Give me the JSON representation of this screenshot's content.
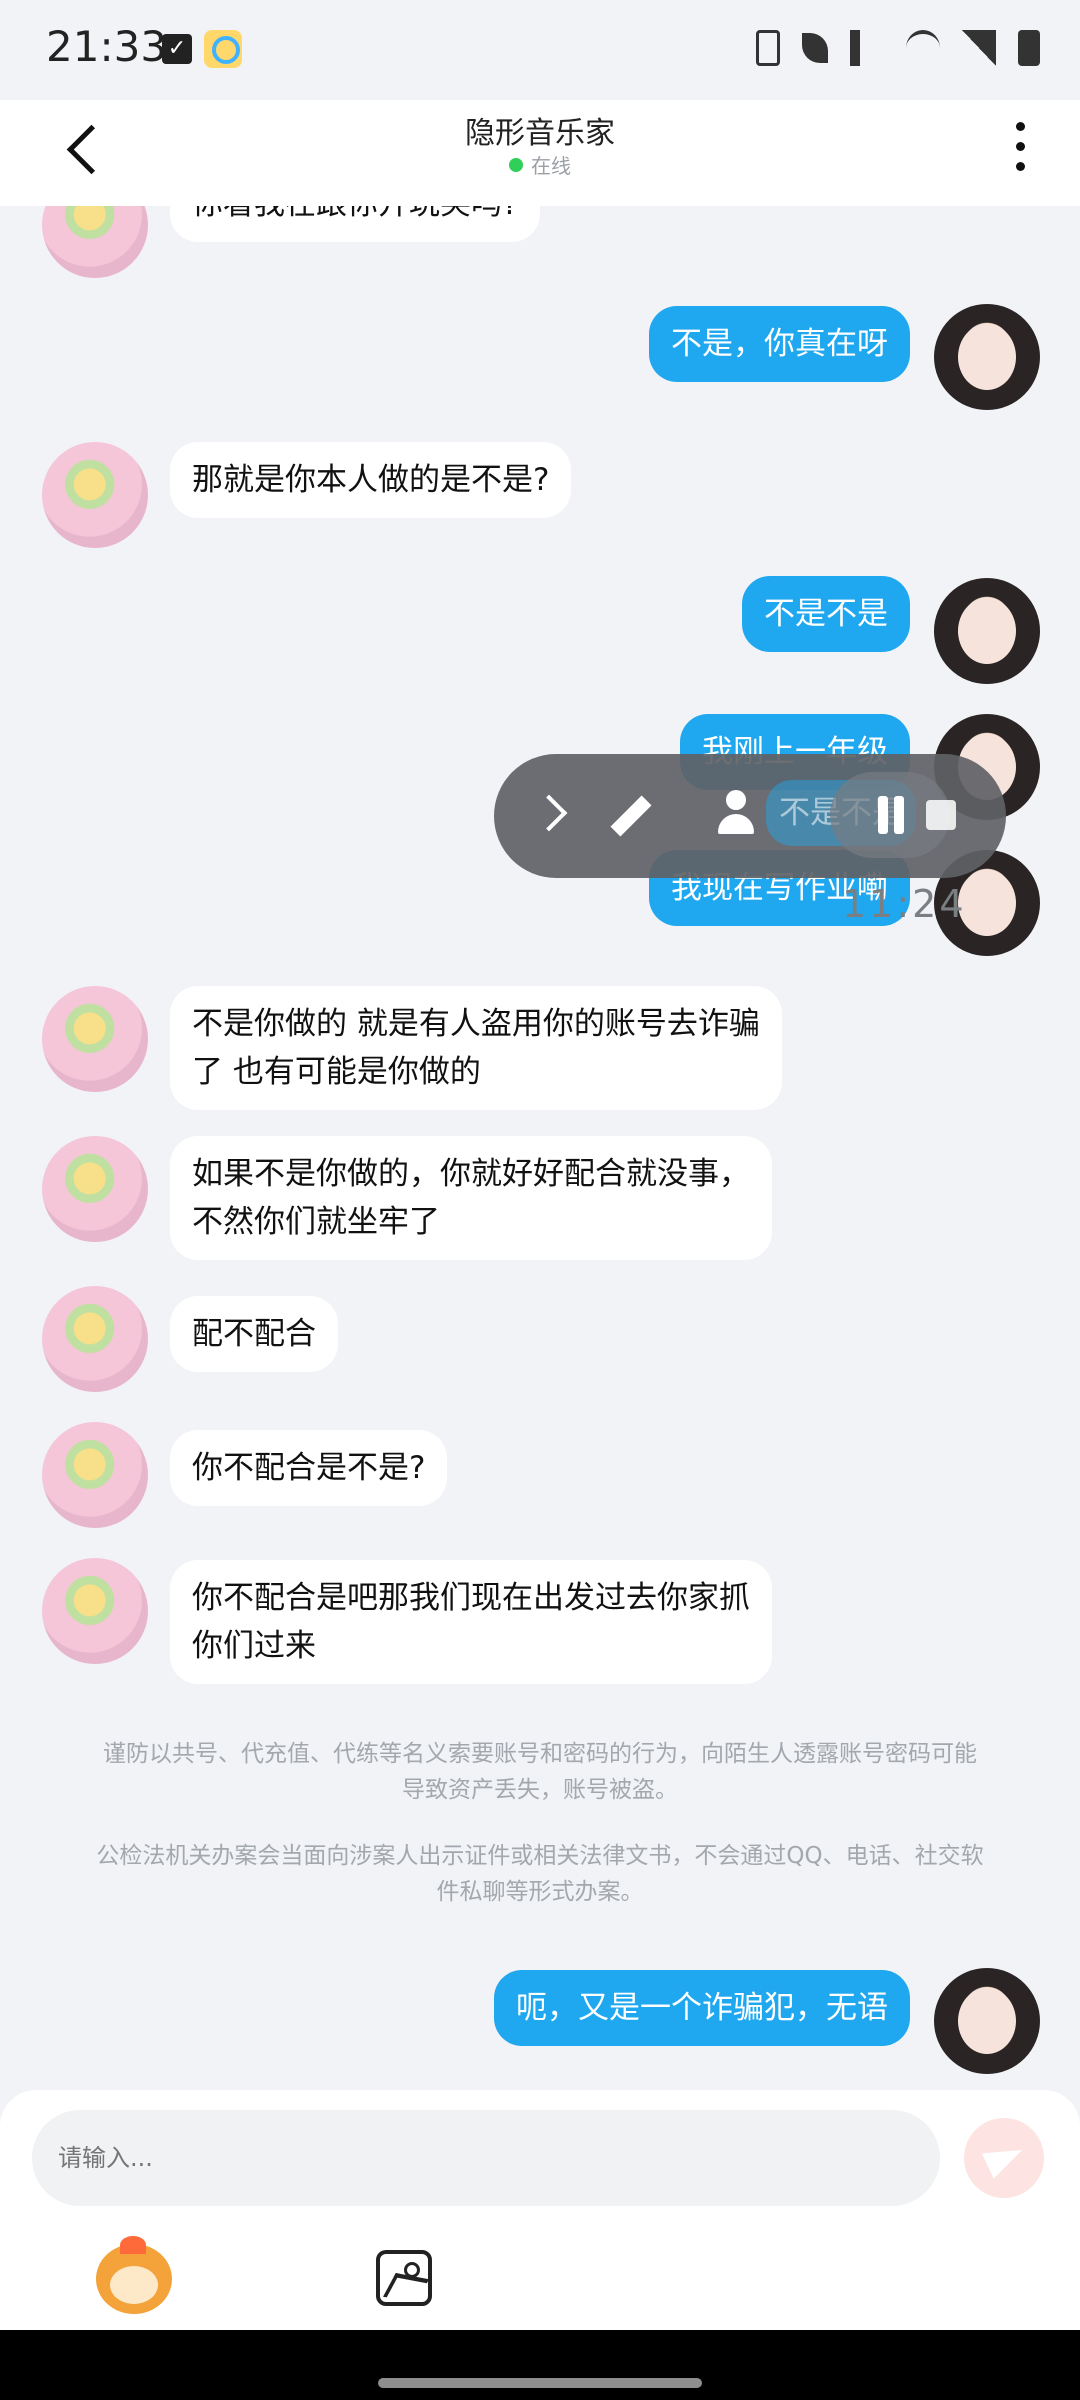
{
  "status_bar": {
    "time": "21:33"
  },
  "header": {
    "title": "隐形音乐家",
    "status": "在线"
  },
  "messages": [
    {
      "from": "other",
      "text": "你看我在跟你开玩笑吗?"
    },
    {
      "from": "me",
      "text": "不是，你真在呀"
    },
    {
      "from": "other",
      "text": "那就是你本人做的是不是?"
    },
    {
      "from": "me",
      "text": "不是不是"
    },
    {
      "from": "me",
      "text": "我刚上一年级"
    },
    {
      "from": "me",
      "text": "我现在写作业嘞"
    },
    {
      "from": "other",
      "text_lines": [
        "不是你做的 就是有人盗用你的账号去诈骗",
        "了 也有可能是你做的"
      ]
    },
    {
      "from": "other",
      "text_lines": [
        "如果不是你做的，你就好好配合就没事，",
        "不然你们就坐牢了"
      ]
    },
    {
      "from": "other",
      "text": "配不配合"
    },
    {
      "from": "other",
      "text": "你不配合是不是?"
    },
    {
      "from": "other",
      "text_lines": [
        "你不配合是吧那我们现在出发过去你家抓",
        "你们过来"
      ]
    },
    {
      "from": "me",
      "text": "呃，又是一个诈骗犯，无语"
    }
  ],
  "notices": {
    "n1_lines": [
      "谨防以共号、代充值、代练等名义索要账号和密码的行为，向陌生人透露账号密码可能",
      "导致资产丢失，账号被盗。"
    ],
    "n2_lines": [
      "公检法机关办案会当面向涉案人出示证件或相关法律文书，不会通过QQ、电话、社交软",
      "件私聊等形式办案。"
    ]
  },
  "recorder": {
    "time": "11:24"
  },
  "input": {
    "placeholder": "请输入..."
  },
  "icons": {
    "back": "back-arrow-icon",
    "more": "more-vertical-icon",
    "send": "send-icon",
    "emoji": "monkey-sticker-icon",
    "image": "image-icon",
    "pause": "pause-icon",
    "stop": "stop-icon",
    "edit": "pencil-icon",
    "person": "person-icon",
    "expand": "chevron-right-icon"
  }
}
